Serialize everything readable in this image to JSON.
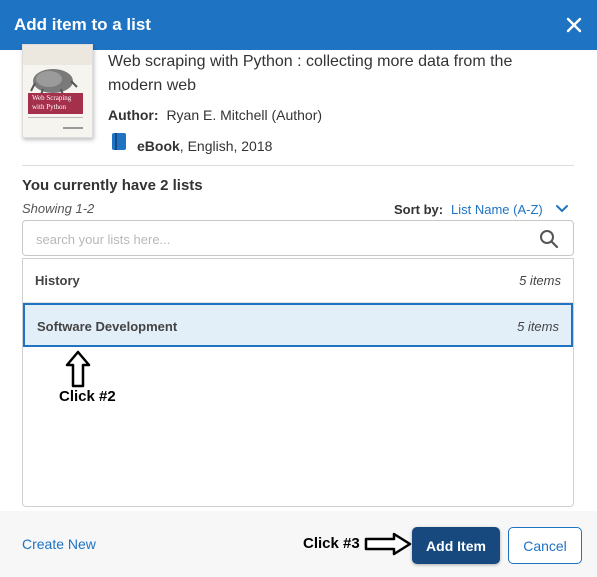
{
  "dialog": {
    "title": "Add item to a list",
    "close_icon": "close-icon"
  },
  "item": {
    "cover_title": "Web Scraping with Python",
    "title": "Web scraping with Python : collecting more data from the modern web",
    "author_label": "Author:",
    "author": "Ryan E. Mitchell (Author)",
    "format_icon": "book-icon",
    "format": "eBook",
    "details": ", English, 2018"
  },
  "lists": {
    "heading": "You currently have 2 lists",
    "showing": "Showing 1-2",
    "sort_label": "Sort by:",
    "sort_value": "List Name (A-Z)",
    "search_placeholder": "search your lists here...",
    "items": [
      {
        "name": "History",
        "count": "5 items"
      },
      {
        "name": "Software Development",
        "count": "5 items"
      }
    ]
  },
  "annotations": {
    "click2": "Click #2",
    "click3": "Click #3"
  },
  "footer": {
    "create_new": "Create New",
    "add_label": "Add Item",
    "cancel_label": "Cancel"
  },
  "colors": {
    "header": "#1f73c3",
    "primary_button": "#17497f",
    "selected_row": "#e2eef8",
    "link": "#1f73c3"
  }
}
